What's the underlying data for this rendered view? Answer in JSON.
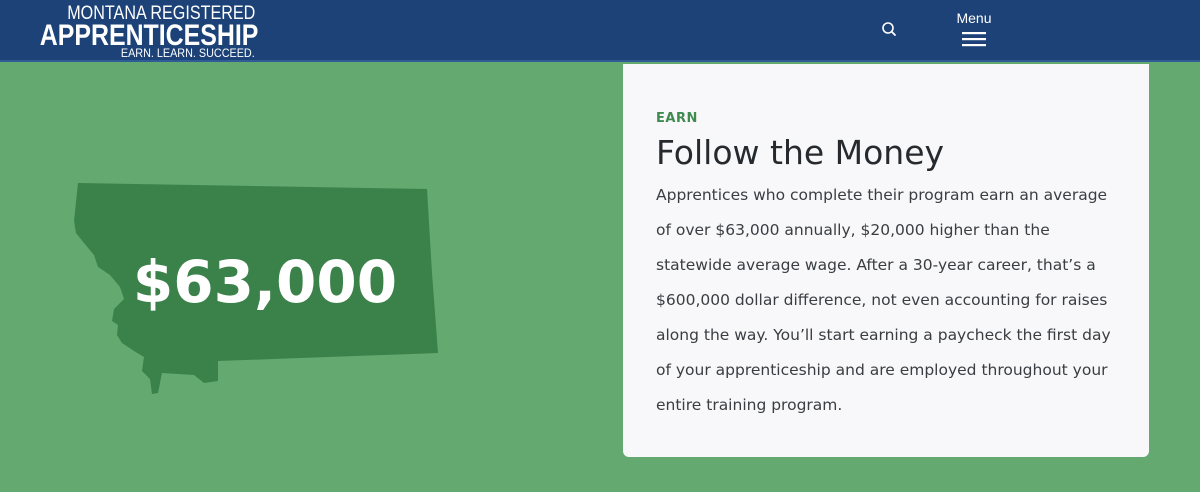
{
  "header": {
    "logo": {
      "line1": "MONTANA REGISTERED",
      "line2": "APPRENTICESHIP",
      "line3": "EARN. LEARN. SUCCEED."
    },
    "search_icon": "search-icon",
    "menu_label": "Menu",
    "menu_icon": "hamburger-icon"
  },
  "hero": {
    "stat": "$63,000",
    "map_icon": "montana-state-shape"
  },
  "card": {
    "eyebrow": "EARN",
    "title": "Follow the Money",
    "body": "Apprentices who complete their program earn an average of over $63,000 annually, $20,000 higher than the statewide average wage. After a 30-year career, that’s a $600,000 dollar difference, not even accounting for raises along the way. You’ll start earning a paycheck the first day of your apprenticeship and are employed throughout your entire training program."
  },
  "colors": {
    "header_bg": "#1c4278",
    "page_bg": "#63a970",
    "map_fill": "#3b824a",
    "accent_green": "#3f8a4e",
    "card_bg": "#f8f8fa"
  }
}
